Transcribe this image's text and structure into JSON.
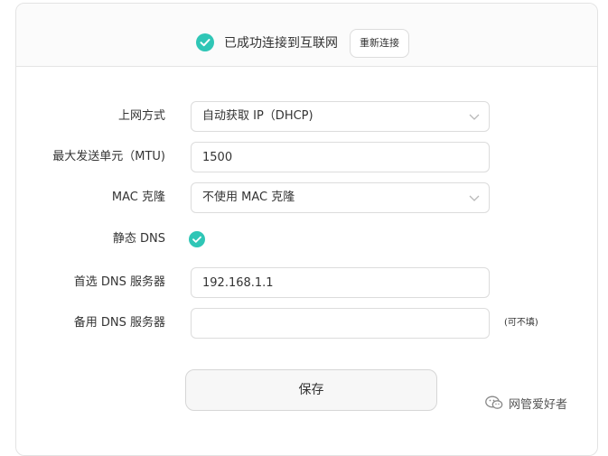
{
  "status": {
    "text": "已成功连接到互联网",
    "reconnect_label": "重新连接",
    "accent_color": "#2fc6b6"
  },
  "form": {
    "connection_type": {
      "label": "上网方式",
      "value": "自动获取 IP（DHCP)"
    },
    "mtu": {
      "label": "最大发送单元（MTU)",
      "value": "1500"
    },
    "mac_clone": {
      "label": "MAC 克隆",
      "value": "不使用 MAC 克隆"
    },
    "static_dns": {
      "label": "静态 DNS",
      "checked": true
    },
    "primary_dns": {
      "label": "首选 DNS 服务器",
      "value": "192.168.1.1"
    },
    "secondary_dns": {
      "label": "备用 DNS 服务器",
      "value": "",
      "hint": "(可不填)"
    }
  },
  "save_label": "保存",
  "watermark": {
    "text": "网管爱好者",
    "icon": "wechat-icon"
  }
}
